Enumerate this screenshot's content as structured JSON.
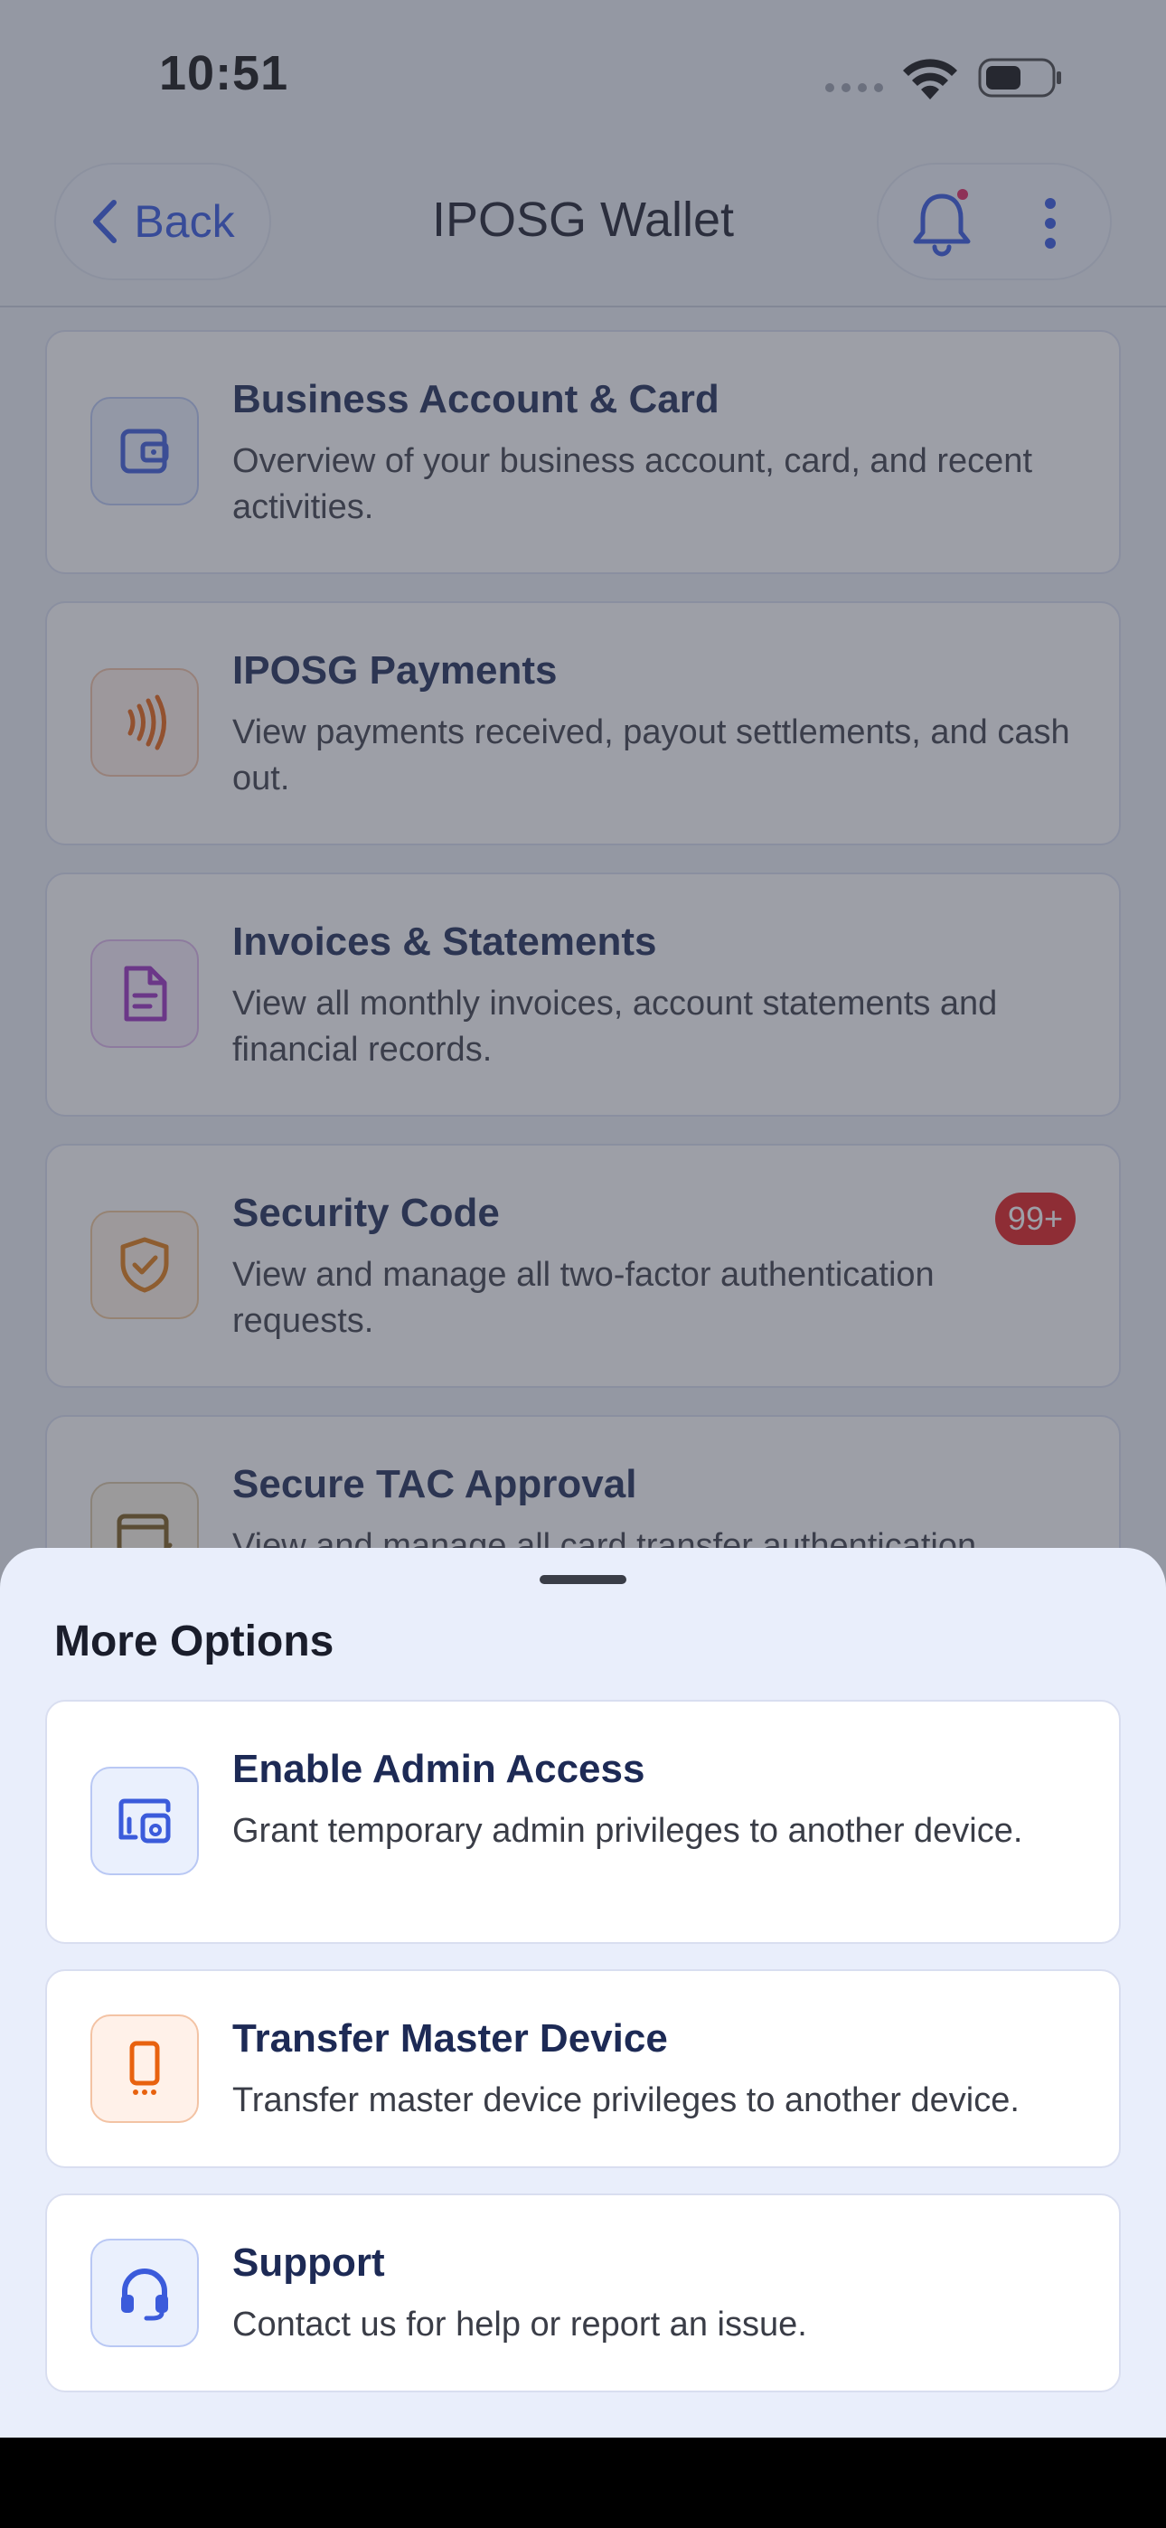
{
  "status_bar": {
    "time": "10:51"
  },
  "header": {
    "back_label": "Back",
    "title": "IPOSG Wallet"
  },
  "menu_items": [
    {
      "title": "Business Account & Card",
      "description": "Overview of your business account, card, and recent activities.",
      "icon": "wallet-icon",
      "accent": "#3b5bdb"
    },
    {
      "title": "IPOSG Payments",
      "description": "View payments received, payout settlements, and cash out.",
      "icon": "contactless-icon",
      "accent": "#e8620f"
    },
    {
      "title": "Invoices & Statements",
      "description": "View all monthly invoices, account statements and financial records.",
      "icon": "document-icon",
      "accent": "#9b2fc1"
    },
    {
      "title": "Security Code",
      "description": "View and manage all two-factor authentication requests.",
      "icon": "shield-check-icon",
      "accent": "#e07a10",
      "badge": "99+"
    },
    {
      "title": "Secure TAC Approval",
      "description": "View and manage all card transfer authentication",
      "icon": "card-check-icon",
      "accent": "#7a5a1a"
    }
  ],
  "sheet": {
    "title": "More Options",
    "items": [
      {
        "title": "Enable Admin Access",
        "description": "Grant temporary admin privileges to another device.",
        "icon": "devices-icon",
        "accent": "#3b5bdb"
      },
      {
        "title": "Transfer Master Device",
        "description": "Transfer master device privileges to another device.",
        "icon": "phone-icon",
        "accent": "#e8620f"
      },
      {
        "title": "Support",
        "description": "Contact us for help or report an issue.",
        "icon": "headset-icon",
        "accent": "#3b5bdb"
      }
    ]
  }
}
